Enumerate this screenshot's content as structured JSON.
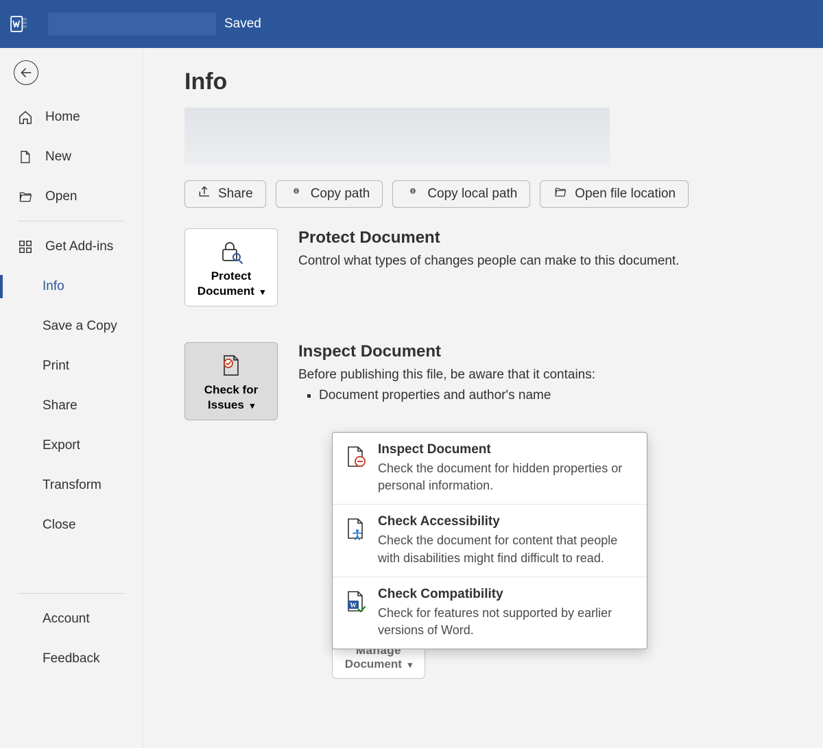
{
  "titlebar": {
    "saved": "Saved"
  },
  "sidebar": {
    "items_top": [
      {
        "label": "Home"
      },
      {
        "label": "New"
      },
      {
        "label": "Open"
      }
    ],
    "addins_label": "Get Add-ins",
    "items_mid": [
      {
        "label": "Info"
      },
      {
        "label": "Save a Copy"
      },
      {
        "label": "Print"
      },
      {
        "label": "Share"
      },
      {
        "label": "Export"
      },
      {
        "label": "Transform"
      },
      {
        "label": "Close"
      }
    ],
    "items_bottom": [
      {
        "label": "Account"
      },
      {
        "label": "Feedback"
      }
    ]
  },
  "main": {
    "title": "Info",
    "actions": [
      {
        "label": "Share"
      },
      {
        "label": "Copy path"
      },
      {
        "label": "Copy local path"
      },
      {
        "label": "Open file location"
      }
    ],
    "protect": {
      "tile_label": "Protect Document",
      "heading": "Protect Document",
      "desc": "Control what types of changes people can make to this document."
    },
    "inspect": {
      "tile_label": "Check for Issues",
      "heading": "Inspect Document",
      "desc": "Before publishing this file, be aware that it contains:",
      "bullet1": "Document properties and author's name"
    },
    "manage": {
      "tile_top": "Manage",
      "tile_bottom": "Document"
    },
    "dropdown": {
      "items": [
        {
          "title": "Inspect Document",
          "desc": "Check the document for hidden properties or personal information."
        },
        {
          "title": "Check Accessibility",
          "desc": "Check the document for content that people with disabilities might find difficult to read."
        },
        {
          "title": "Check Compatibility",
          "desc": "Check for features not supported by earlier versions of Word."
        }
      ]
    }
  }
}
